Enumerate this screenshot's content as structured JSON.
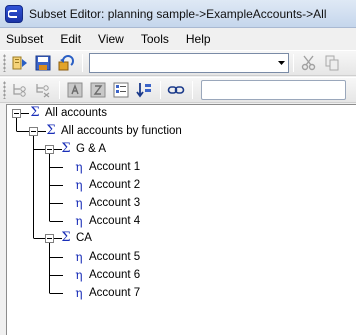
{
  "window": {
    "title": "Subset Editor:  planning sample->ExampleAccounts->All"
  },
  "menu": {
    "items": [
      "Subset",
      "Edit",
      "View",
      "Tools",
      "Help"
    ]
  },
  "toolbar1": {
    "combo_value": ""
  },
  "tree": {
    "root": {
      "label": "All accounts"
    },
    "group": {
      "label": "All accounts by function"
    },
    "ga": {
      "label": "G & A",
      "accounts": [
        "Account 1",
        "Account 2",
        "Account 3",
        "Account 4"
      ]
    },
    "ca": {
      "label": "CA",
      "accounts": [
        "Account 5",
        "Account 6",
        "Account 7"
      ]
    }
  },
  "colors": {
    "consolidated_icon": "#1a2fb8",
    "leaf_icon": "#1a2fb8",
    "title_bar": "#c5d6ec"
  }
}
